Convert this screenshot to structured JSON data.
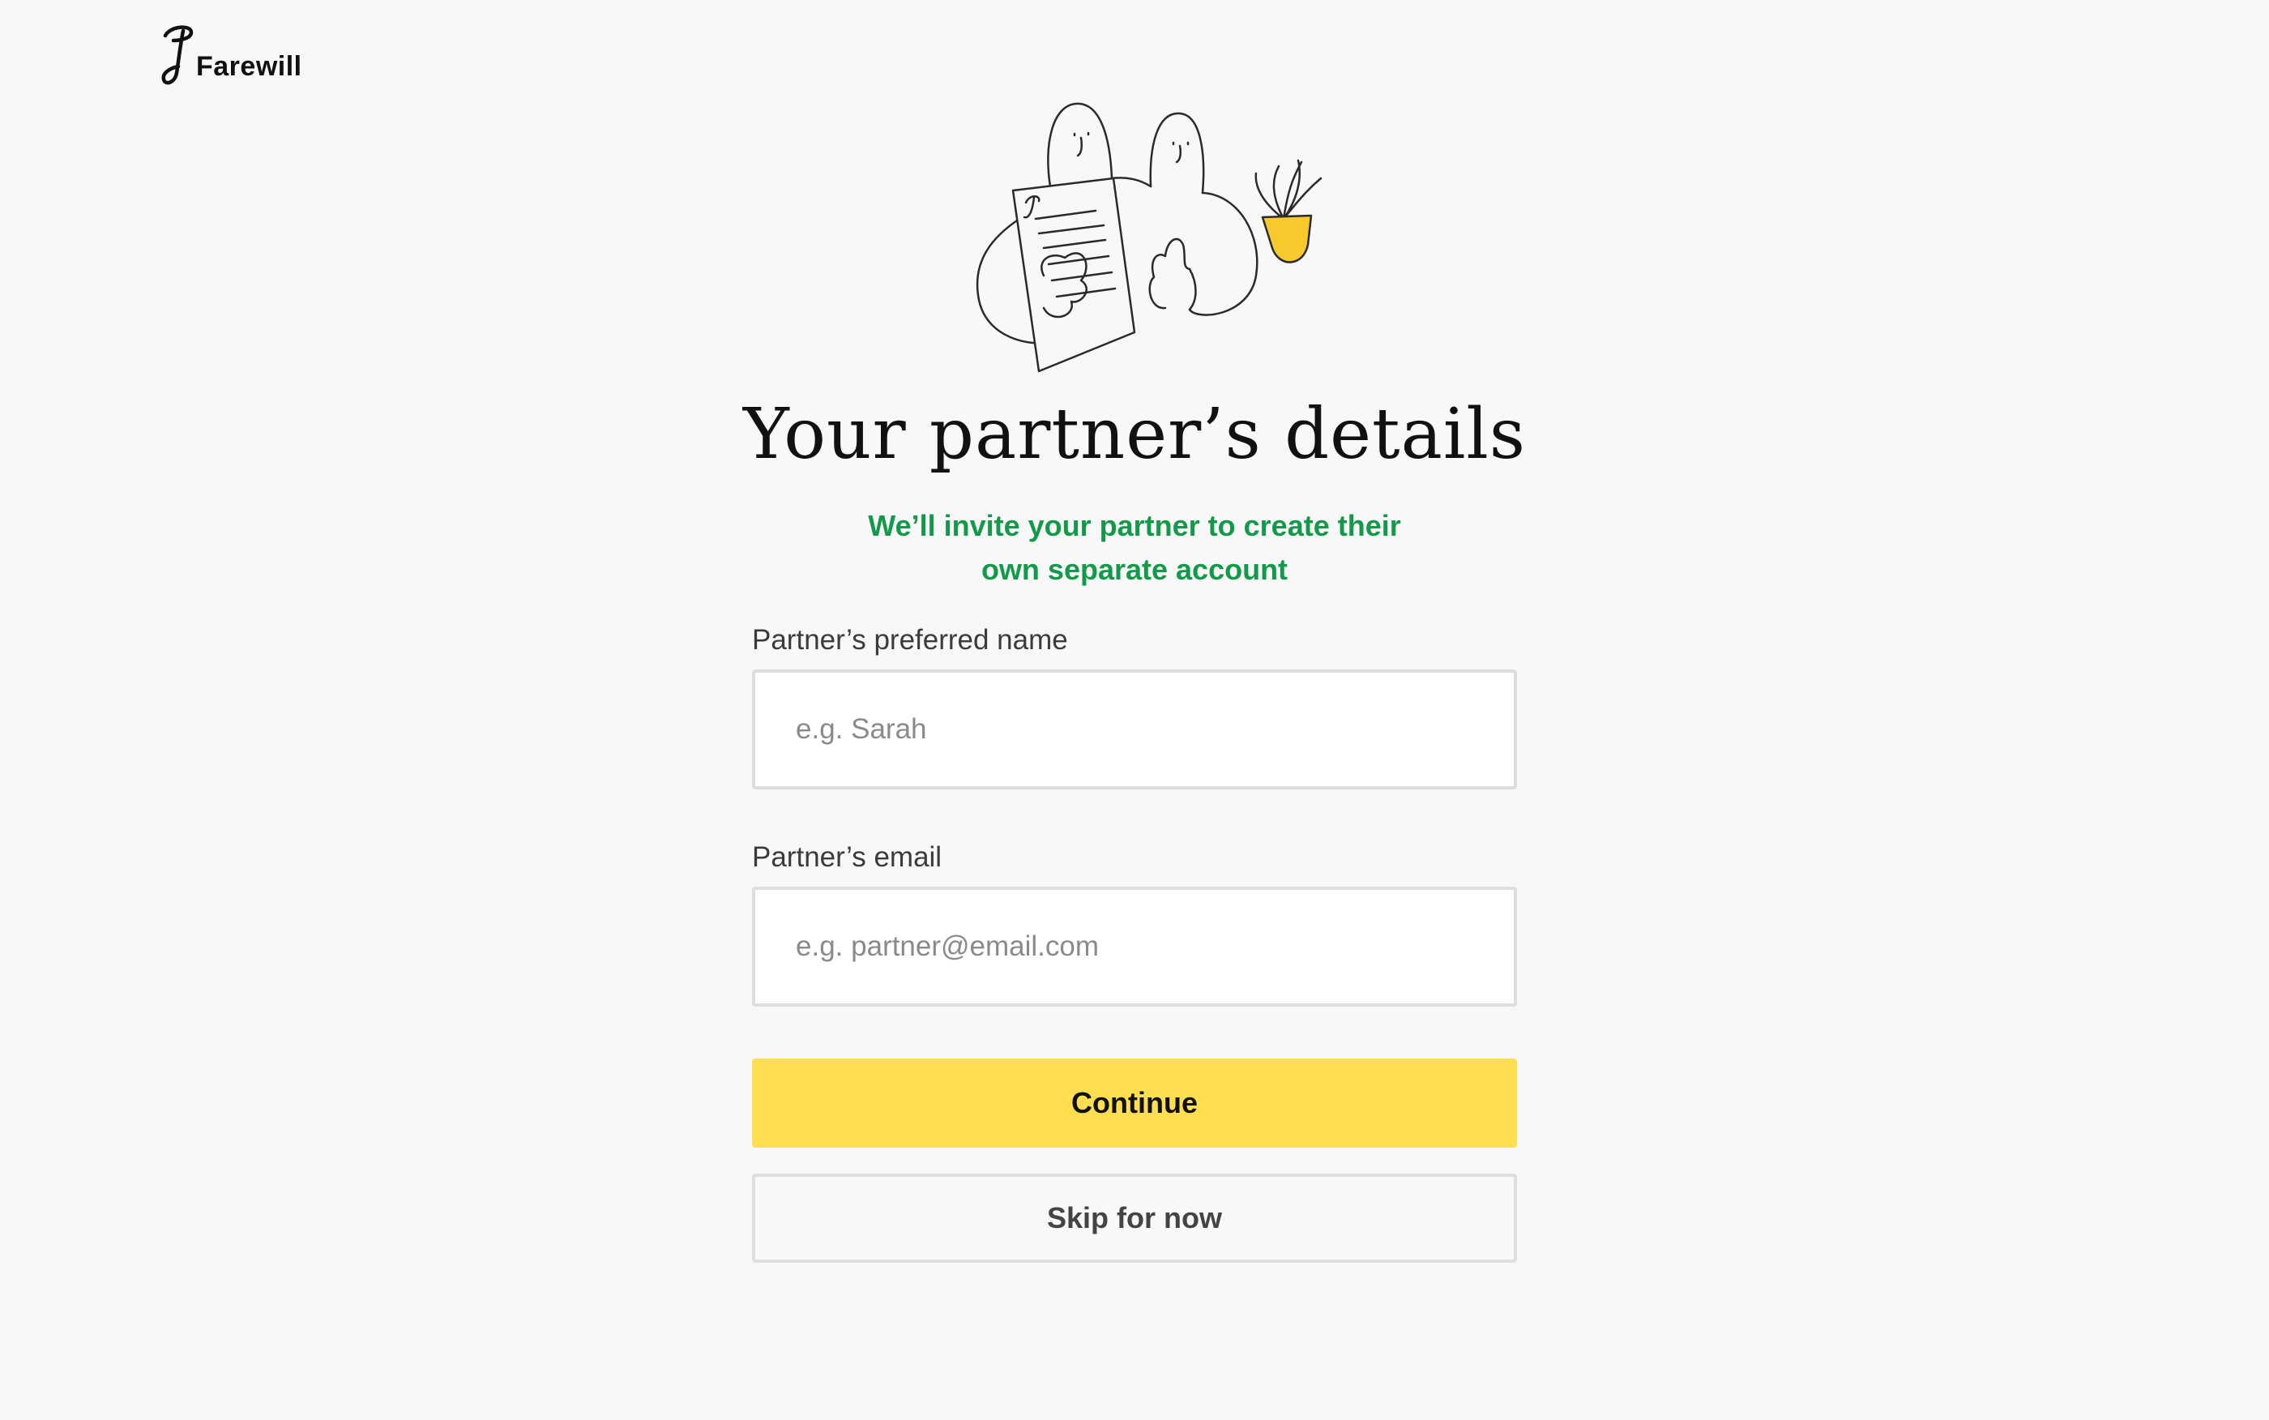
{
  "header": {
    "logo_text": "Farewill"
  },
  "illustration": {
    "icon": "two-people-reading-will-illustration"
  },
  "main": {
    "title": "Your partner’s details",
    "subtitle_line1": "We’ll invite your partner to create their",
    "subtitle_line2": "own separate account"
  },
  "form": {
    "name_label": "Partner’s preferred name",
    "name_placeholder": "e.g. Sarah",
    "name_value": "",
    "email_label": "Partner’s email",
    "email_placeholder": "e.g. partner@email.com",
    "email_value": "",
    "continue_label": "Continue",
    "skip_label": "Skip for now"
  },
  "colors": {
    "background": "#f8f8f8",
    "accent_green": "#13994a",
    "button_yellow": "#ffdf4f",
    "input_border": "#dedede"
  }
}
